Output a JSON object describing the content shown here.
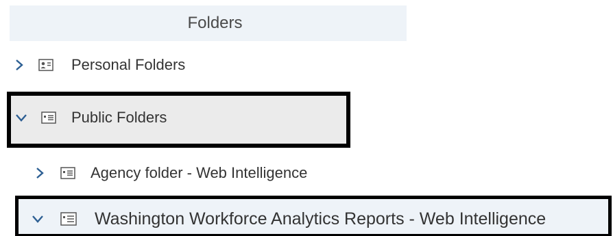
{
  "panel": {
    "title": "Folders"
  },
  "tree": {
    "items": [
      {
        "label": "Personal Folders",
        "expanded": false,
        "level": 0,
        "icon": "personal-folder-icon"
      },
      {
        "label": "Public Folders",
        "expanded": true,
        "level": 0,
        "icon": "folder-icon",
        "highlighted": true
      },
      {
        "label": "Agency folder - Web Intelligence",
        "expanded": false,
        "level": 1,
        "icon": "folder-icon"
      },
      {
        "label": "Washington Workforce Analytics Reports - Web Intelligence",
        "expanded": true,
        "level": 1,
        "icon": "folder-icon",
        "highlighted": true
      }
    ]
  },
  "colors": {
    "chevron": "#2d5f93",
    "header_bg": "#eef3f8",
    "highlight_border": "#000000",
    "selected_bg": "#ebebeb"
  }
}
